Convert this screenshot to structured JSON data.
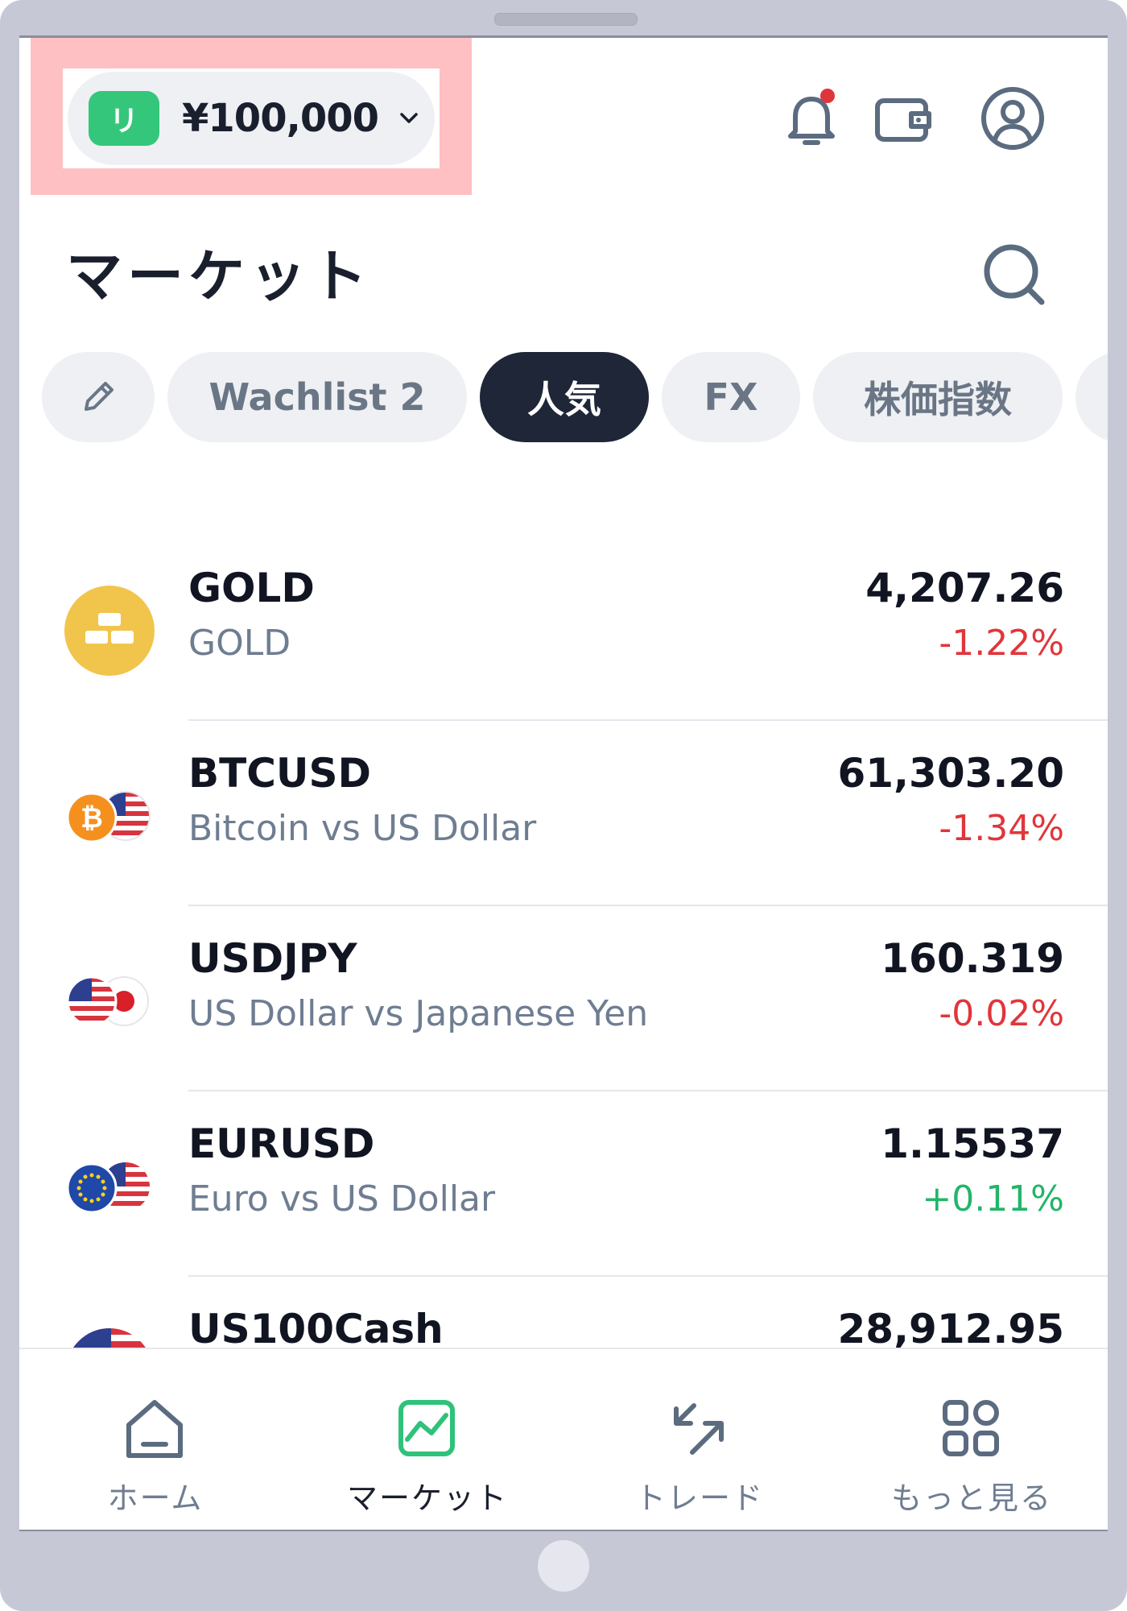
{
  "colors": {
    "accent_green": "#34c77b",
    "dark": "#1e2638",
    "negative": "#e0363b",
    "positive": "#22b569",
    "muted": "#6f7d92",
    "highlight": "#ffc0c3"
  },
  "header": {
    "account_badge": "リ",
    "balance": "¥100,000",
    "icons": [
      "bell-icon",
      "wallet-icon",
      "user-icon"
    ]
  },
  "page": {
    "title": "マーケット"
  },
  "tabs": [
    {
      "label": "",
      "icon": "pencil-icon"
    },
    {
      "label": "Wachlist 2"
    },
    {
      "label": "人気",
      "active": true
    },
    {
      "label": "FX"
    },
    {
      "label": "株価指数"
    }
  ],
  "instruments": [
    {
      "symbol": "GOLD",
      "name": "GOLD",
      "price": "4,207.26",
      "change": "-1.22%",
      "direction": "down",
      "icon": "gold-bars-icon"
    },
    {
      "symbol": "BTCUSD",
      "name": "Bitcoin vs US Dollar",
      "price": "61,303.20",
      "change": "-1.34%",
      "direction": "down",
      "icon": "btc-usd-flag-icon"
    },
    {
      "symbol": "USDJPY",
      "name": "US Dollar vs Japanese Yen",
      "price": "160.319",
      "change": "-0.02%",
      "direction": "down",
      "icon": "usd-jpy-flag-icon"
    },
    {
      "symbol": "EURUSD",
      "name": "Euro vs US Dollar",
      "price": "1.15537",
      "change": "+0.11%",
      "direction": "up",
      "icon": "eur-usd-flag-icon"
    },
    {
      "symbol": "US100Cash",
      "name": "",
      "price": "28,912.95",
      "change": "",
      "direction": "",
      "icon": "us-flag-icon"
    }
  ],
  "bottom_nav": [
    {
      "label": "ホーム",
      "icon": "home-icon"
    },
    {
      "label": "マーケット",
      "icon": "market-chart-icon",
      "active": true
    },
    {
      "label": "トレード",
      "icon": "trade-arrows-icon"
    },
    {
      "label": "もっと見る",
      "icon": "more-grid-icon"
    }
  ]
}
